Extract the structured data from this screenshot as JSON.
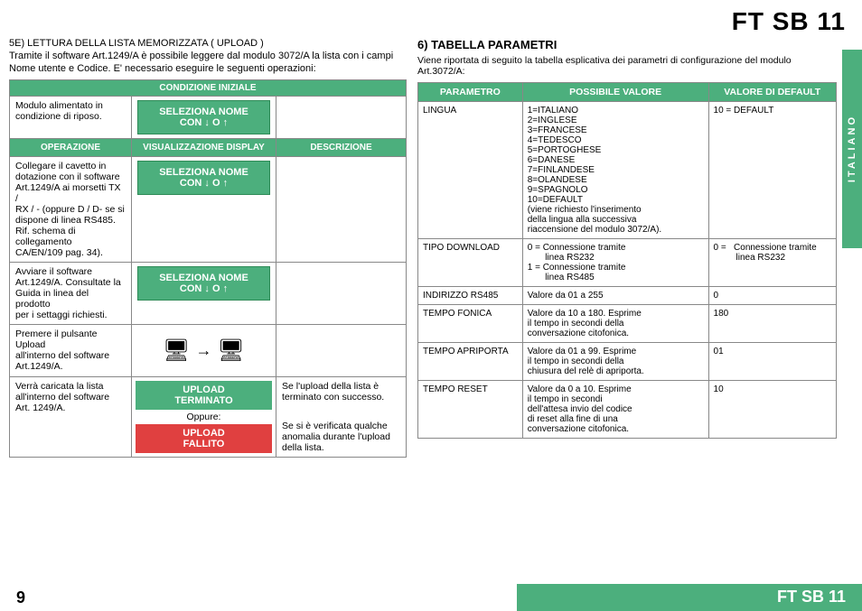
{
  "header": {
    "title": "FT SB 11"
  },
  "side_tab": {
    "text": "ITALIANO"
  },
  "left_section": {
    "title_line1": "5E) LETTURA DELLA LISTA  MEMORIZZATA ( UPLOAD )",
    "title_line2": "Tramite il software Art.1249/A è possibile leggere dal modulo 3072/A la lista con i campi",
    "title_line3": "Nome utente e Codice. E' necessario eseguire le seguenti operazioni:",
    "cond_header": "CONDIZIONE INIZIALE",
    "op_header": "OPERAZIONE",
    "vis_header": "VISUALIZZAZIONE DISPLAY",
    "desc_header": "DESCRIZIONE",
    "row1_op": "Modulo alimentato in\ncondizione di riposo.",
    "row1_vis1": "SELEZIONA NOME",
    "row1_vis2": "CON  ↓ O ↑",
    "row2_op": "Collegare il cavetto in\ndotazione con il software\nArt.1249/A ai morsetti TX /\nRX / -  (oppure D / D- se si\ndispone di linea RS485.\nRif. schema di collegamento\nCA/EN/109 pag. 34).",
    "row2_vis1": "SELEZIONA NOME",
    "row2_vis2": "CON ↓ O ↑",
    "row3_op": "Avviare il software\nArt.1249/A. Consultate la\nGuida in linea del prodotto\nper i settaggi richiesti.",
    "row3_vis1": "SELEZIONA NOME",
    "row3_vis2": "CON ↓ O ↑",
    "row4_op": "Premere il pulsante Upload\nall'interno del software\nArt.1249/A.",
    "row5_op": "Verrà caricata la lista\nall'interno del software\nArt. 1249/A.",
    "row5_vis_upload_ok": "UPLOAD\nTERMINATO",
    "row5_oppure": "Oppure:",
    "row5_vis_upload_fail": "UPLOAD\nFALLITO",
    "row5_desc1": "Se l'upload della lista è\nterminato con successo.",
    "row5_desc2": "Se si è verificata qualche\nanomalia durante l'upload\ndella lista."
  },
  "right_section": {
    "title": "6) TABELLA PARAMETRI",
    "subtitle": "Viene riportata di seguito la tabella esplicativa dei parametri di configurazione del modulo Art.3072/A:",
    "col_param": "PARAMETRO",
    "col_value": "POSSIBILE VALORE",
    "col_default": "VALORE DI DEFAULT",
    "rows": [
      {
        "param": "LINGUA",
        "value": "1=ITALIANO\n2=INGLESE\n3=FRANCESE\n4=TEDESCO\n5=PORTOGHESE\n6=DANESE\n7=FINLANDESE\n8=OLANDESE\n9=SPAGNOLO\n10=DEFAULT\n(viene richiesto l'inserimento\ndella lingua alla successiva\nriaccensione del modulo 3072/A).",
        "default": "10 = DEFAULT"
      },
      {
        "param": "TIPO DOWNLOAD",
        "value": "0 =  Connessione tramite\n       linea RS232\n1 =  Connessione tramite\n       linea RS485",
        "default": "0 =    Connessione tramite\n          linea RS232"
      },
      {
        "param": "INDIRIZZO RS485",
        "value": "Valore da 01 a 255",
        "default": "0"
      },
      {
        "param": "TEMPO FONICA",
        "value": "Valore da 10 a 180. Esprime\nil tempo in secondi della\nconversazione citofonica.",
        "default": "180"
      },
      {
        "param": "TEMPO APRIPORTA",
        "value": "Valore da 01 a 99. Esprime\nil tempo in secondi della\nchiusura del relè di apriporta.",
        "default": "01"
      },
      {
        "param": "TEMPO RESET",
        "value": "Valore da 0 a 10. Esprime\nil tempo in secondi\ndell'attesa invio del codice\ndi reset alla fine di una\nconversazione citofonica.",
        "default": "10"
      }
    ]
  },
  "footer": {
    "page": "9",
    "title": "FT SB 11"
  }
}
